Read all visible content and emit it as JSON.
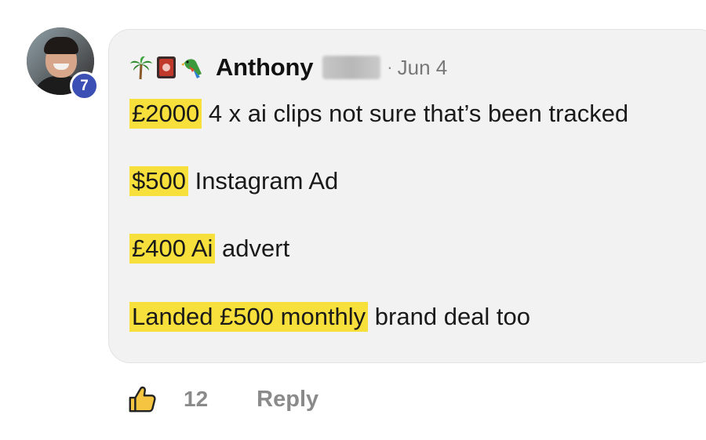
{
  "comment": {
    "avatar_badge": "7",
    "author_emojis": [
      "palm-tree-icon",
      "red-card-icon",
      "parrot-icon"
    ],
    "author_name": "Anthony",
    "separator": "·",
    "date": "Jun 4",
    "lines": [
      {
        "highlight": "£2000",
        "text": " 4 x ai clips not sure that’s been tracked"
      },
      {
        "highlight": "$500",
        "text": " Instagram Ad"
      },
      {
        "highlight": "£400 Ai",
        "text": " advert"
      },
      {
        "highlight": "Landed £500 monthly",
        "text": " brand deal too"
      }
    ]
  },
  "actions": {
    "like_count": "12",
    "reply_label": "Reply"
  },
  "colors": {
    "highlight": "#f7e03b",
    "badge": "#3b4fb4",
    "bubble": "#f2f2f2",
    "muted_text": "#8a8a8a"
  }
}
